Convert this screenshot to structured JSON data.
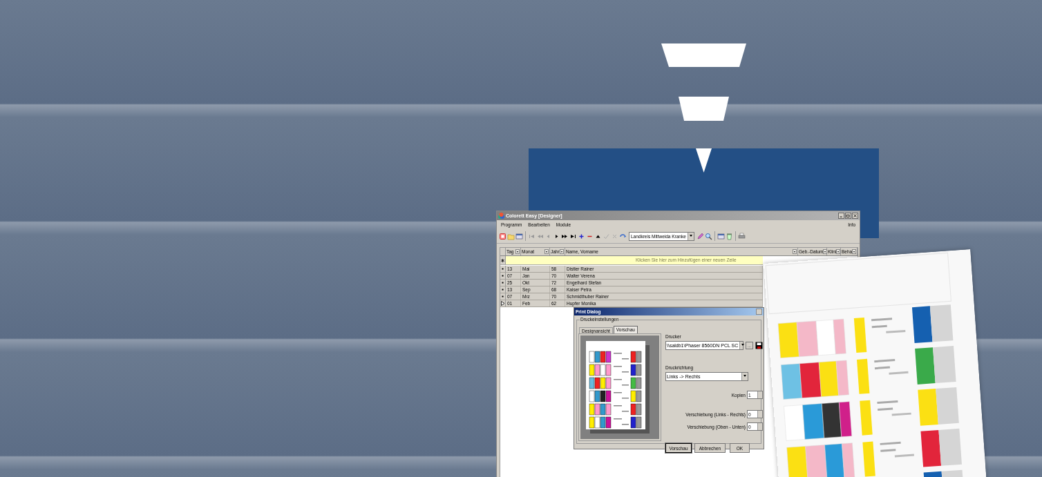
{
  "window": {
    "title": "Colorett Easy [Designer]"
  },
  "menu": {
    "items": [
      {
        "label": "Programm"
      },
      {
        "label": "Bearbeiten"
      },
      {
        "label": "Module"
      }
    ],
    "right_item": "Info"
  },
  "toolbar": {
    "dataset": "Landkreis Mittweida Kranke"
  },
  "grid": {
    "columns": [
      {
        "label": "Tag"
      },
      {
        "label": "Monat"
      },
      {
        "label": "Jahr"
      },
      {
        "label": "Name, Vorname"
      },
      {
        "label": "Geb.-Datum"
      },
      {
        "label": "Klini"
      },
      {
        "label": "Beha"
      }
    ],
    "new_row": "Klicken Sie hier zum Hinzufügen einer neuen Zeile",
    "rows": [
      {
        "cells": [
          "13",
          "Mai",
          "58",
          "Distler Rainer"
        ],
        "current": false
      },
      {
        "cells": [
          "07",
          "Jan",
          "70",
          "Walter Verena"
        ],
        "current": false
      },
      {
        "cells": [
          "25",
          "Okt",
          "72",
          "Engelhard Stefan"
        ],
        "current": false
      },
      {
        "cells": [
          "13",
          "Sep",
          "68",
          "Kaiser Petra"
        ],
        "current": false
      },
      {
        "cells": [
          "07",
          "Mrz",
          "70",
          "Schmidthuber Rainer"
        ],
        "current": false
      },
      {
        "cells": [
          "01",
          "Feb",
          "62",
          "Hupfer Monika"
        ],
        "current": true
      }
    ]
  },
  "print_dialog": {
    "title": "Print Dialog",
    "group": "Druckeinstellungen",
    "tabs": [
      {
        "label": "Designansicht",
        "selected": false
      },
      {
        "label": "Vorschau",
        "selected": true
      }
    ],
    "printer_label": "Drucker",
    "printer": "\\\\saldb1\\Phaser 8560DN PCL SC",
    "browse_button": "...",
    "direction_label": "Druckrichtung",
    "direction": "Links -> Rechts",
    "fields": [
      {
        "label": "Kopien",
        "value": "1"
      },
      {
        "label": "Verschiebung (Links - Rechts)",
        "value": "0"
      },
      {
        "label": "Verschiebung (Oben - Unten)",
        "value": "0"
      }
    ],
    "buttons": [
      "Vorschau",
      "Abbrechen",
      "OK"
    ]
  }
}
